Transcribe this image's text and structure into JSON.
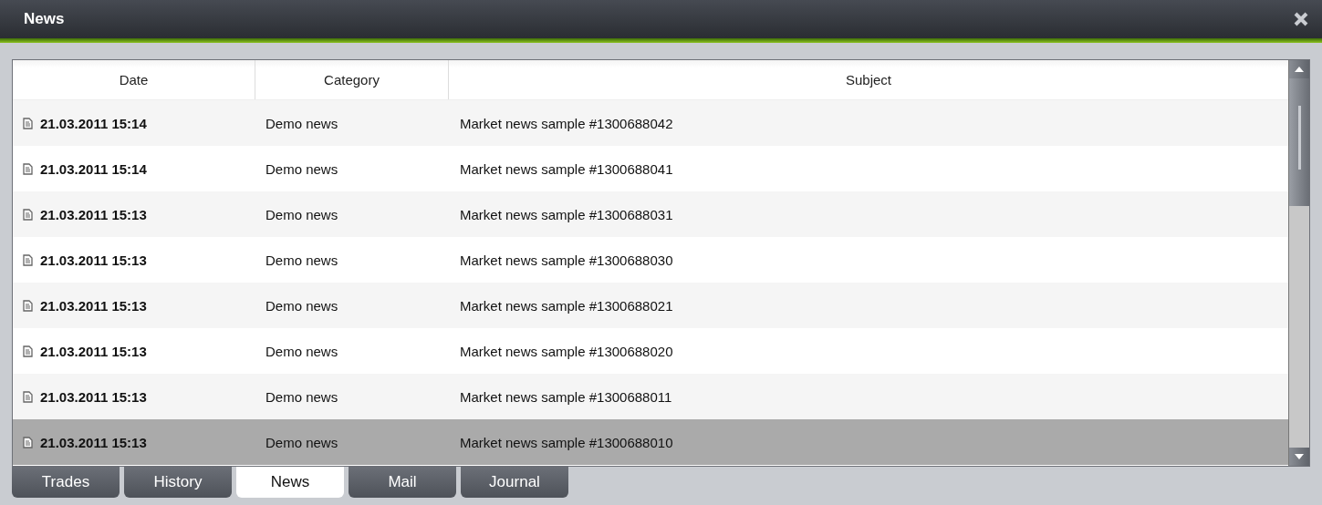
{
  "window": {
    "title": "News"
  },
  "table": {
    "columns": [
      "Date",
      "Category",
      "Subject"
    ],
    "rows": [
      {
        "date": "21.03.2011 15:14",
        "category": "Demo news",
        "subject": "Market news sample #1300688042",
        "selected": false
      },
      {
        "date": "21.03.2011 15:14",
        "category": "Demo news",
        "subject": "Market news sample #1300688041",
        "selected": false
      },
      {
        "date": "21.03.2011 15:13",
        "category": "Demo news",
        "subject": "Market news sample #1300688031",
        "selected": false
      },
      {
        "date": "21.03.2011 15:13",
        "category": "Demo news",
        "subject": "Market news sample #1300688030",
        "selected": false
      },
      {
        "date": "21.03.2011 15:13",
        "category": "Demo news",
        "subject": "Market news sample #1300688021",
        "selected": false
      },
      {
        "date": "21.03.2011 15:13",
        "category": "Demo news",
        "subject": "Market news sample #1300688020",
        "selected": false
      },
      {
        "date": "21.03.2011 15:13",
        "category": "Demo news",
        "subject": "Market news sample #1300688011",
        "selected": false
      },
      {
        "date": "21.03.2011 15:13",
        "category": "Demo news",
        "subject": "Market news sample #1300688010",
        "selected": true
      }
    ]
  },
  "tabs": [
    {
      "label": "Trades",
      "selected": false
    },
    {
      "label": "History",
      "selected": false
    },
    {
      "label": "News",
      "selected": true
    },
    {
      "label": "Mail",
      "selected": false
    },
    {
      "label": "Journal",
      "selected": false
    }
  ]
}
